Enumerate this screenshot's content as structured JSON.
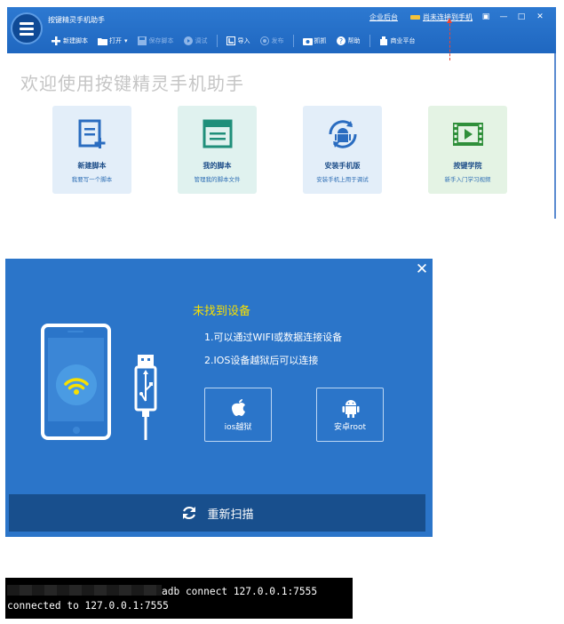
{
  "app": {
    "title": "按键精灵手机助手",
    "enterprise_link": "企业后台",
    "device_status": "尚未连接到手机",
    "toolbar": [
      {
        "id": "new",
        "label": "新建脚本",
        "icon": "plus-icon",
        "enabled": true
      },
      {
        "id": "open",
        "label": "打开",
        "icon": "folder-icon",
        "enabled": true,
        "has_dropdown": true
      },
      {
        "id": "save",
        "label": "保存脚本",
        "icon": "save-icon",
        "enabled": false
      },
      {
        "id": "debug",
        "label": "调试",
        "icon": "play-icon",
        "enabled": false
      },
      {
        "id": "import",
        "label": "导入",
        "icon": "import-icon",
        "enabled": true
      },
      {
        "id": "publish",
        "label": "发布",
        "icon": "publish-icon",
        "enabled": false
      },
      {
        "id": "capture",
        "label": "抓抓",
        "icon": "camera-icon",
        "enabled": true
      },
      {
        "id": "help",
        "label": "帮助",
        "icon": "help-icon",
        "enabled": true
      },
      {
        "id": "biz",
        "label": "商业平台",
        "icon": "biz-icon",
        "enabled": true
      }
    ],
    "welcome": "欢迎使用按键精灵手机助手",
    "tiles": [
      {
        "title": "新建脚本",
        "subtitle": "我要写一个脚本",
        "icon": "new-script-icon",
        "bg": "#e3eef9",
        "color": "#2a6cc0"
      },
      {
        "title": "我的脚本",
        "subtitle": "管理我的脚本文件",
        "icon": "my-scripts-icon",
        "bg": "#e0f2ef",
        "color": "#1f8f7a"
      },
      {
        "title": "安装手机版",
        "subtitle": "安装手机上用于调试",
        "icon": "install-android-icon",
        "bg": "#e3eef9",
        "color": "#2a6cc0"
      },
      {
        "title": "按键学院",
        "subtitle": "新手入门学习视频",
        "icon": "video-academy-icon",
        "bg": "#e4f3e4",
        "color": "#2f8f3a"
      }
    ]
  },
  "dialog": {
    "no_device": "未找到设备",
    "tips": [
      "1.可以通过WIFI或数据连接设备",
      "2.IOS设备越狱后可以连接"
    ],
    "ios_button": "ios越狱",
    "android_button": "安卓root",
    "rescan": "重新扫描"
  },
  "terminal": {
    "command": "adb connect 127.0.0.1:7555",
    "output": "connected to 127.0.0.1:7555"
  },
  "colors": {
    "titlebar": "#2470c8",
    "dialog_bg": "#2b75c9",
    "rescan_bar": "#184f8d",
    "warning_text": "#f8e000",
    "annotation_arrow": "#e43"
  }
}
